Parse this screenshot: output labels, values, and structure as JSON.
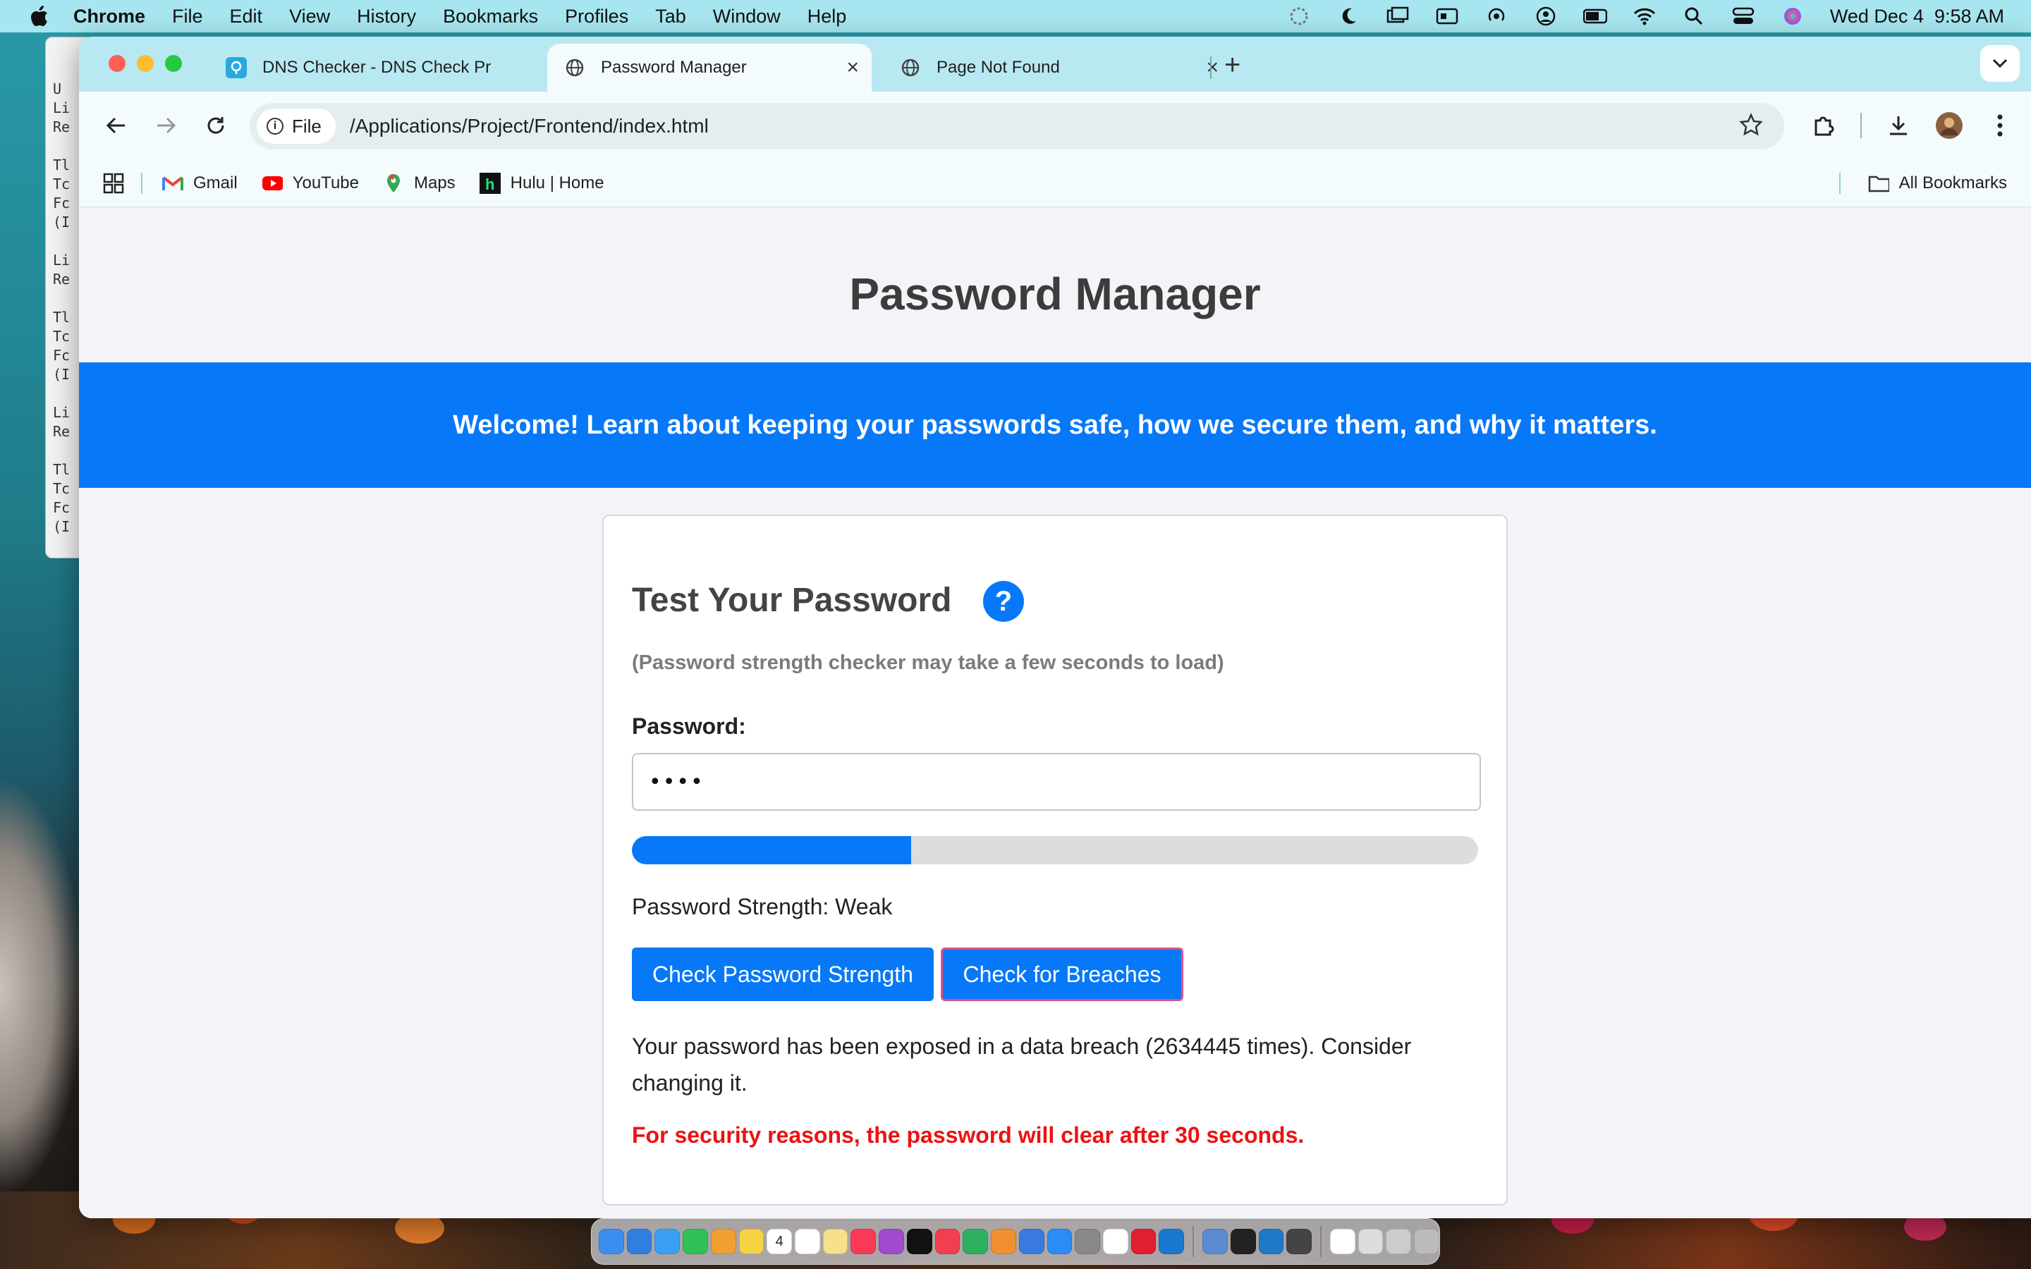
{
  "menubar": {
    "app_name": "Chrome",
    "items": [
      "File",
      "Edit",
      "View",
      "History",
      "Bookmarks",
      "Profiles",
      "Tab",
      "Window",
      "Help"
    ],
    "datetime": "Wed Dec 4  9:58 AM",
    "status_icons": [
      "focus-icon",
      "moon-icon",
      "screen-mirror-icon",
      "display-icon",
      "airdrop-icon",
      "user-icon",
      "battery-icon",
      "wifi-icon",
      "spotlight-icon",
      "control-center-icon",
      "siri-icon"
    ]
  },
  "browser": {
    "tabs": [
      {
        "label": "DNS Checker - DNS Check Pr",
        "icon": "dns-checker-icon",
        "active": false
      },
      {
        "label": "Password Manager",
        "icon": "globe-icon",
        "active": true
      },
      {
        "label": "Page Not Found",
        "icon": "globe-icon",
        "active": false
      }
    ],
    "omnibox": {
      "chip": "File",
      "url": "/Applications/Project/Frontend/index.html"
    },
    "bookmarks": [
      {
        "label": "Gmail",
        "icon": "gmail-icon"
      },
      {
        "label": "YouTube",
        "icon": "youtube-icon"
      },
      {
        "label": "Maps",
        "icon": "maps-icon"
      },
      {
        "label": "Hulu | Home",
        "icon": "hulu-icon"
      }
    ],
    "all_bookmarks": "All Bookmarks"
  },
  "page": {
    "title": "Password Manager",
    "banner": "Welcome! Learn about keeping your passwords safe, how we secure them, and why it matters.",
    "card": {
      "title": "Test Your Password",
      "help": "?",
      "load_note": "(Password strength checker may take a few seconds to load)",
      "password_label": "Password:",
      "password_value": "••••",
      "strength_fraction": 0.33,
      "strength_text": "Password Strength: Weak",
      "check_strength_label": "Check Password Strength",
      "check_breaches_label": "Check for Breaches",
      "breach_message": "Your password has been exposed in a data breach (2634445 times). Consider changing it.",
      "security_message": "For security reasons, the password will clear after 30 seconds."
    }
  },
  "colors": {
    "accent": "#0778f7",
    "warning": "#ee1111",
    "tabstrip": "#b8e9f2",
    "menubar": "#a7e6f0"
  },
  "background_window_text": [
    "U",
    "Li",
    "Re",
    "Tl",
    "Tc",
    "Fc",
    "(I",
    "Li",
    "Re",
    "Tl",
    "Tc",
    "Fc",
    "(I",
    "Li",
    "Re",
    "Tl",
    "Tc",
    "Fc",
    "(I"
  ],
  "dock": {
    "apps": [
      "finder-icon",
      "safari-icon",
      "mail-icon",
      "facetime-icon",
      "photos-icon",
      "notes-icon",
      "calendar-icon",
      "reminders-icon",
      "stickies-icon",
      "music-icon",
      "podcasts-icon",
      "tv-icon",
      "news-icon",
      "numbers-icon",
      "pages-icon",
      "keynote-icon",
      "app-store-icon",
      "settings-icon",
      "chrome-icon",
      "opera-icon",
      "xcode-icon",
      "preview-icon",
      "terminal-icon",
      "vscode-icon",
      "ssh-icon",
      "document-icon",
      "help-icon",
      "mail-stack-icon",
      "trash-icon"
    ],
    "calendar_day": "4"
  }
}
